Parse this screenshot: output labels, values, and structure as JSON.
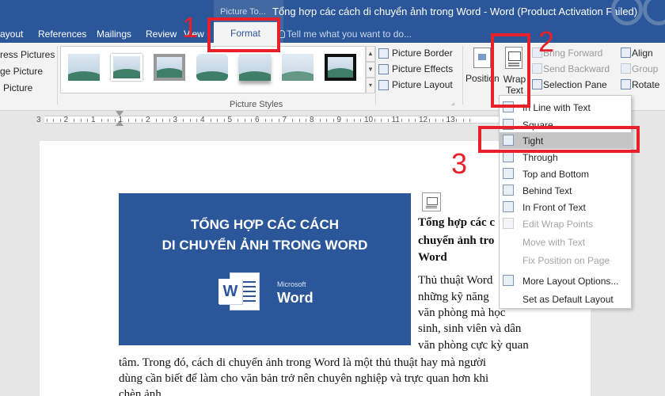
{
  "window": {
    "context_label": "Picture To...",
    "doc_title": "Tổng hợp các cách di chuyển ảnh trong Word - Word (Product Activation Failed)"
  },
  "tabs": [
    {
      "label": "ayout"
    },
    {
      "label": "References"
    },
    {
      "label": "Mailings"
    },
    {
      "label": "Review"
    },
    {
      "label": "View"
    }
  ],
  "active_tab": "Format",
  "tell_me": "Tell me what you want to do...",
  "ribbon": {
    "adjust": {
      "compress": "ress Pictures",
      "change": "ge Picture",
      "reset": "Picture"
    },
    "styles_group_label": "Picture Styles",
    "picture_border": "Picture Border",
    "picture_effects": "Picture Effects",
    "picture_layout": "Picture Layout",
    "position": "Position",
    "wrap_text": "Wrap Text",
    "bring_forward": "Bring Forward",
    "send_backward": "Send Backward",
    "selection_pane": "Selection Pane",
    "align": "Align",
    "group": "Group",
    "rotate": "Rotate"
  },
  "ruler": {
    "numbers": [
      "3",
      "2",
      "1",
      "1",
      "2",
      "3",
      "4",
      "5",
      "6",
      "7",
      "8",
      "9",
      "10",
      "11",
      "12",
      "13"
    ]
  },
  "document": {
    "image_line1": "TỔNG HỢP CÁC CÁCH",
    "image_line2": "DI CHUYỂN ẢNH TRONG WORD",
    "ms_label": "Microsoft",
    "word_label": "Word",
    "logo_letter": "W",
    "heading_lines": [
      "Tổng hợp các c",
      "chuyển ảnh tro",
      "Word"
    ],
    "body_lines": [
      "Thủ thuật Word",
      "những kỹ năng",
      "văn phòng mà học",
      "sinh, sinh viên và dân",
      "văn phòng cực kỳ quan",
      "tâm. Trong đó, cách di chuyển ảnh trong Word là một thủ thuật hay mà người",
      "dùng cần biết để làm cho văn bản trở nên chuyên nghiệp và trực quan hơn khi",
      "chèn ảnh."
    ]
  },
  "wrap_menu": {
    "items": [
      {
        "label": "In Line with Text",
        "enabled": true
      },
      {
        "label": "Square",
        "enabled": true
      },
      {
        "label": "Tight",
        "enabled": true
      },
      {
        "label": "Through",
        "enabled": true
      },
      {
        "label": "Top and Bottom",
        "enabled": true
      },
      {
        "label": "Behind Text",
        "enabled": true
      },
      {
        "label": "In Front of Text",
        "enabled": true
      },
      {
        "label": "Edit Wrap Points",
        "enabled": false
      },
      {
        "label": "Move with Text",
        "enabled": false
      },
      {
        "label": "Fix Position on Page",
        "enabled": false
      },
      {
        "label": "More Layout Options...",
        "enabled": true
      },
      {
        "label": "Set as Default Layout",
        "enabled": true
      }
    ]
  },
  "annotations": {
    "step1": "1",
    "step2": "2",
    "step3": "3"
  },
  "colors": {
    "word_blue": "#2b579a",
    "annotation_red": "#e8202a"
  }
}
